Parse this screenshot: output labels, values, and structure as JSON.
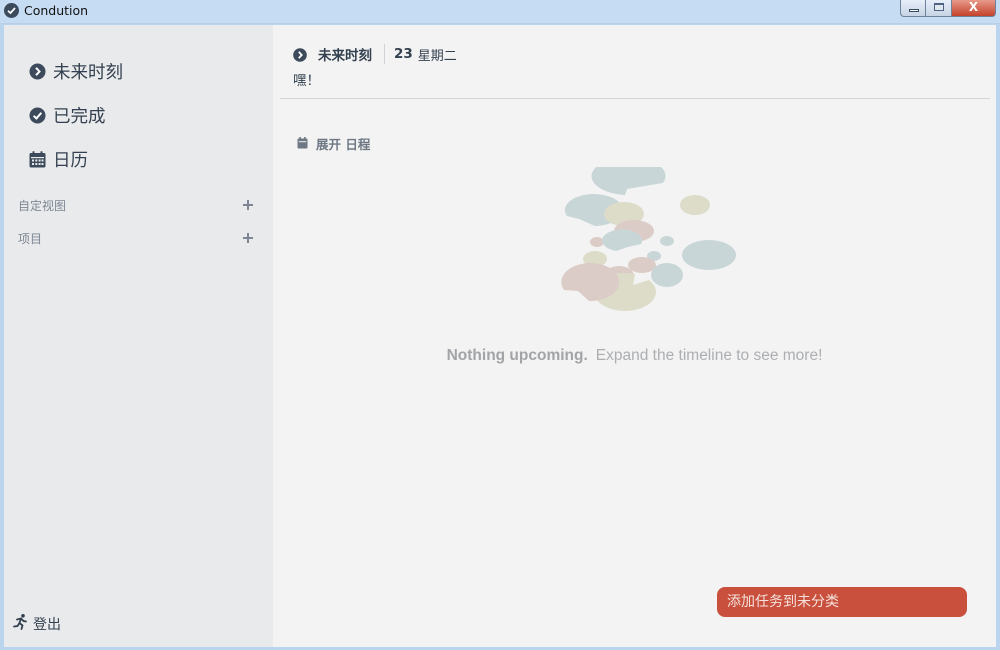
{
  "window": {
    "title": "Condution",
    "buttons": {
      "close_glyph": "X"
    }
  },
  "sidebar": {
    "nav": [
      {
        "label": "未来时刻",
        "icon": "chevron-right-circle-icon"
      },
      {
        "label": "已完成",
        "icon": "check-circle-icon"
      },
      {
        "label": "日历",
        "icon": "calendar-icon"
      }
    ],
    "sections": [
      {
        "label": "自定视图",
        "icon": "plus-icon"
      },
      {
        "label": "项目",
        "icon": "plus-icon"
      }
    ],
    "logout_label": "登出"
  },
  "main": {
    "header": {
      "title": "未来时刻",
      "day": "23",
      "weekday": "星期二"
    },
    "greeting": "嘿！",
    "expand_label": "展开 日程",
    "empty": {
      "strong": "Nothing upcoming.",
      "hint": "Expand the timeline to see more!"
    },
    "add_button_label": "添加任务到未分类"
  },
  "colors": {
    "accent": "#c8503d",
    "text": "#33404f",
    "sidebar_bg": "#e9eaec",
    "main_bg": "#f3f3f3"
  }
}
